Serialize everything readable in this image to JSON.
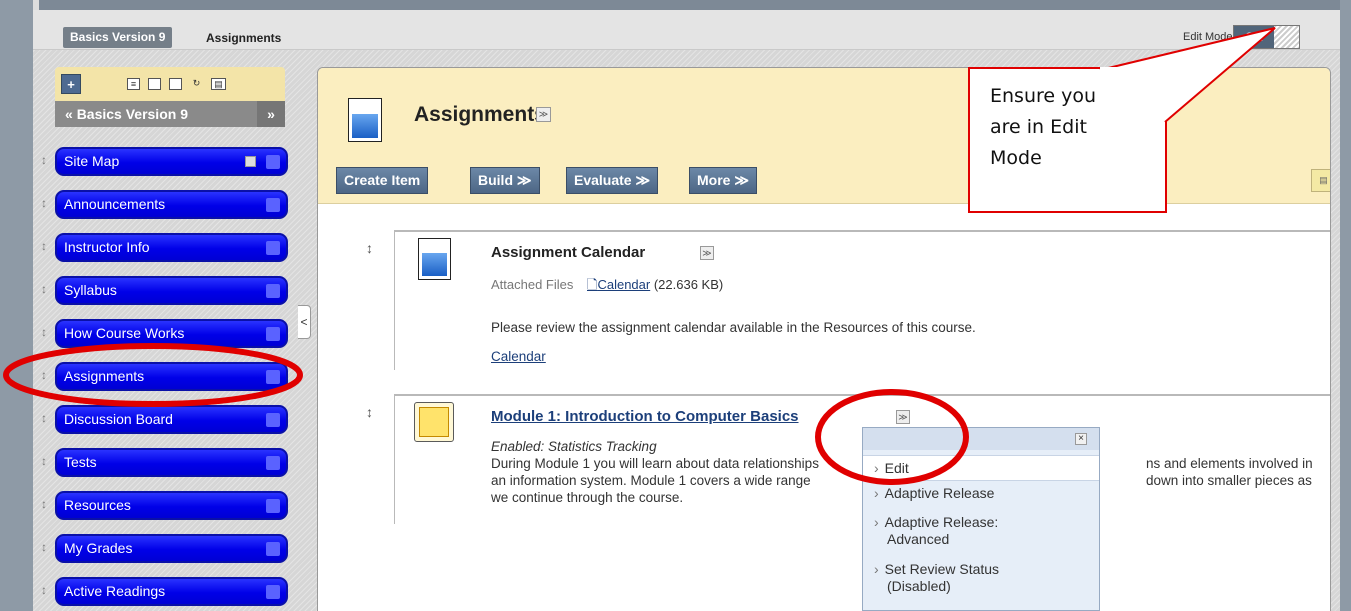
{
  "breadcrumb": {
    "course": "Basics Version 9",
    "current": "Assignments"
  },
  "edit_mode": {
    "label": "Edit Mode:",
    "state": "ON"
  },
  "course_menu": {
    "title": "Basics Version 9",
    "header_arrow": "«",
    "collapse": "»",
    "add": "+",
    "items": [
      {
        "label": "Site Map"
      },
      {
        "label": "Announcements"
      },
      {
        "label": "Instructor Info"
      },
      {
        "label": "Syllabus"
      },
      {
        "label": "How Course Works"
      },
      {
        "label": "Assignments"
      },
      {
        "label": "Discussion Board"
      },
      {
        "label": "Tests"
      },
      {
        "label": "Resources"
      },
      {
        "label": "My Grades"
      },
      {
        "label": "Active Readings"
      }
    ],
    "drag_glyph": "↕",
    "collapse_handle": "<"
  },
  "page": {
    "title": "Assignments",
    "actions": [
      "Create Item",
      "Build ≫",
      "Evaluate ≫",
      "More ≫"
    ]
  },
  "items": [
    {
      "title": "Assignment Calendar",
      "attached_label": "Attached Files",
      "attached_link": "Calendar",
      "attached_size": "(22.636 KB)",
      "description": "Please review the assignment calendar available in the Resources of this course.",
      "link": "Calendar"
    },
    {
      "title": "Module 1: Introduction to Computer Basics",
      "enabled": "Enabled: Statistics Tracking",
      "line1_start": "During Module 1 you will learn about data relationships",
      "line1_end": "ns and elements involved in",
      "line2_start": "an information system.  Module 1 covers a wide range",
      "line2_end": "down into smaller pieces as",
      "line3": "we continue through the course."
    }
  ],
  "context_menu": {
    "close": "×",
    "items": [
      {
        "label": "Edit"
      },
      {
        "label": "Adaptive Release"
      },
      {
        "label": "Adaptive Release:",
        "label2": "Advanced"
      },
      {
        "label": "Set Review Status",
        "label2": "(Disabled)"
      }
    ],
    "arrow": "›"
  },
  "callout": {
    "line1": "Ensure you",
    "line2": "are in Edit",
    "line3": "Mode"
  },
  "colors": {
    "annotation_red": "#e00000",
    "menu_blue": "#0000e8",
    "header_yellow": "#fbeec0"
  }
}
